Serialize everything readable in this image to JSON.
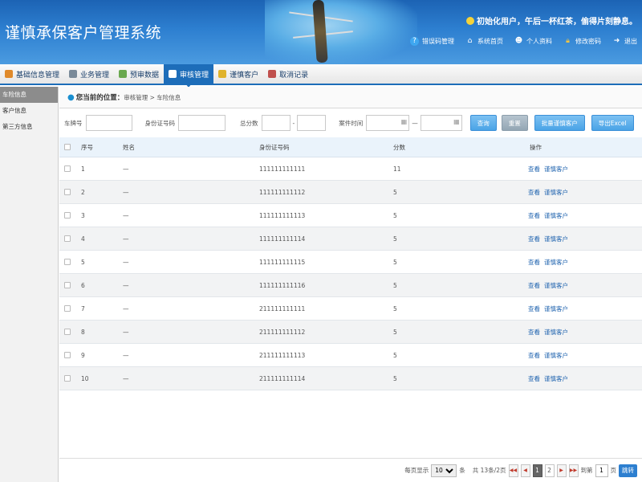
{
  "app": {
    "title": "谨慎承保客户管理系统",
    "welcome": "初始化用户，午后一杯红茶，偷得片刻静息。"
  },
  "toplinks": [
    {
      "label": "错误码管理",
      "icon": "question-icon"
    },
    {
      "label": "系统首页",
      "icon": "home-icon"
    },
    {
      "label": "个人资料",
      "icon": "user-icon"
    },
    {
      "label": "修改密码",
      "icon": "lock-icon"
    },
    {
      "label": "退出",
      "icon": "exit-icon"
    }
  ],
  "menu": [
    {
      "label": "基础信息管理",
      "icon_color": "#e08a2b"
    },
    {
      "label": "业务管理",
      "icon_color": "#7a8a99"
    },
    {
      "label": "预审数据",
      "icon_color": "#6aa84f"
    },
    {
      "label": "审核管理",
      "icon_color": "#ffffff",
      "active": true
    },
    {
      "label": "谨慎客户",
      "icon_color": "#e0b32b"
    },
    {
      "label": "取消记录",
      "icon_color": "#c0504d"
    }
  ],
  "sidebar": [
    {
      "label": "车险信息",
      "active": true
    },
    {
      "label": "客户信息"
    },
    {
      "label": "第三方信息"
    }
  ],
  "breadcrumb": {
    "label": "您当前的位置：",
    "path": "审核管理 > 车险信息"
  },
  "filters": {
    "plate_label": "车牌号",
    "id_label": "身份证号码",
    "score_label": "总分数",
    "score_sep": "-",
    "time_label": "案件时间",
    "time_sep": "—",
    "query_btn": "查询",
    "reset_btn": "重置",
    "batch_btn": "批量谨慎客户",
    "export_btn": "导出Excel"
  },
  "table": {
    "headers": [
      "序号",
      "姓名",
      "身份证号码",
      "分数",
      "操作"
    ],
    "op_view": "查看",
    "op_mark": "谨慎客户",
    "rows": [
      {
        "no": "1",
        "name": "—",
        "id": "111111111111",
        "score": "11"
      },
      {
        "no": "2",
        "name": "—",
        "id": "111111111112",
        "score": "5"
      },
      {
        "no": "3",
        "name": "—",
        "id": "111111111113",
        "score": "5"
      },
      {
        "no": "4",
        "name": "—",
        "id": "111111111114",
        "score": "5"
      },
      {
        "no": "5",
        "name": "—",
        "id": "111111111115",
        "score": "5"
      },
      {
        "no": "6",
        "name": "—",
        "id": "111111111116",
        "score": "5"
      },
      {
        "no": "7",
        "name": "—",
        "id": "211111111111",
        "score": "5"
      },
      {
        "no": "8",
        "name": "—",
        "id": "211111111112",
        "score": "5"
      },
      {
        "no": "9",
        "name": "—",
        "id": "211111111113",
        "score": "5"
      },
      {
        "no": "10",
        "name": "—",
        "id": "211111111114",
        "score": "5"
      }
    ]
  },
  "pager": {
    "per_page_label": "每页显示",
    "per_page_value": "10",
    "unit": "条",
    "summary": "共 13条/2页",
    "pages": [
      "1",
      "2"
    ],
    "current_page": "1",
    "goto_label": "到第",
    "goto_value": "1",
    "page_unit": "页",
    "go_btn": "跳转"
  }
}
